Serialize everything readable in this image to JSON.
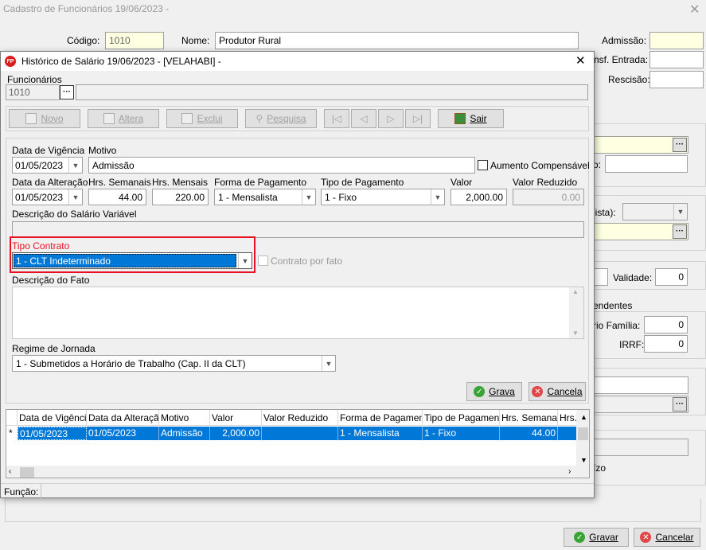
{
  "main_window": {
    "title": "Cadastro de Funcionários  19/06/2023 -",
    "codigo_label": "Código:",
    "codigo_value": "1010",
    "nome_label": "Nome:",
    "nome_value": "Produtor Rural",
    "admissao_label": "Admissão:",
    "transf_entrada_label": "nsf. Entrada:",
    "rescisao_label": "Rescisão:",
    "frag_o": "o:",
    "frag_lista": "lista):",
    "validade_label": "Validade:",
    "validade_value": "0",
    "dependentes_label": "endentes",
    "salario_familia_label": "rio Família:",
    "salario_familia_value": "0",
    "irrf_label": "IRRF:",
    "irrf_value": "0",
    "frag_izo": "ízo",
    "gravar_label": "Gravar",
    "cancelar_label": "Cancelar"
  },
  "dialog": {
    "title": "Histórico de Salário 19/06/2023 - [VELAHABI] -",
    "funcionarios_label": "Funcionários",
    "funcionarios_value": "1010",
    "toolbar": {
      "novo": "Novo",
      "altera": "Altera",
      "exclui": "Exclui",
      "pesquisa": "Pesquisa",
      "sair": "Sair"
    },
    "form": {
      "data_vigencia_label": "Data de Vigência",
      "data_vigencia_value": "01/05/2023",
      "motivo_label": "Motivo",
      "motivo_value": "Admissão",
      "aumento_compensavel_label": "Aumento Compensável",
      "data_alteracao_label": "Data da Alteração",
      "data_alteracao_value": "01/05/2023",
      "hrs_semanais_label": "Hrs. Semanais",
      "hrs_semanais_value": "44.00",
      "hrs_mensais_label": "Hrs. Mensais",
      "hrs_mensais_value": "220.00",
      "forma_pagamento_label": "Forma de Pagamento",
      "forma_pagamento_value": "1  -  Mensalista",
      "tipo_pagamento_label": "Tipo de Pagamento",
      "tipo_pagamento_value": "1 - Fixo",
      "valor_label": "Valor",
      "valor_value": "2,000.00",
      "valor_reduzido_label": "Valor Reduzido",
      "valor_reduzido_value": "0.00",
      "descricao_salario_variavel_label": "Descrição do Salário Variável",
      "tipo_contrato_label": "Tipo Contrato",
      "tipo_contrato_value": "1  -  CLT Indeterminado",
      "contrato_por_fato_label": "Contrato por fato",
      "descricao_fato_label": "Descrição do Fato",
      "regime_jornada_label": "Regime de Jornada",
      "regime_jornada_value": "1 - Submetidos a Horário de Trabalho (Cap. II da CLT)",
      "grava_label": "Grava",
      "cancela_label": "Cancela"
    },
    "grid": {
      "columns": [
        "Data de Vigência",
        "Data da Alteração",
        "Motivo",
        "Valor",
        "Valor Reduzido",
        "Forma de Pagamento",
        "Tipo de Pagamento",
        "Hrs. Semanais",
        "Hrs."
      ],
      "row_marker": "*",
      "row": [
        "01/05/2023",
        "01/05/2023",
        "Admissão",
        "2,000.00",
        "",
        "1 - Mensalista",
        "1 - Fixo",
        "44.00",
        ""
      ]
    },
    "status_funcao_label": "Função:"
  },
  "colors": {
    "selection_blue": "#0078d7",
    "highlight_red": "#e81123",
    "yellow_field": "#ffffe1"
  }
}
